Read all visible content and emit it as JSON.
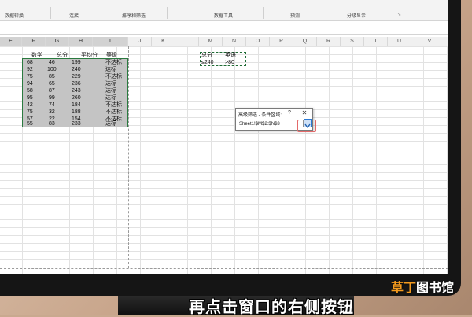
{
  "ribbon": {
    "groups": [
      "数据转换",
      "连接",
      "排序和筛选",
      "数据工具",
      "预测",
      "分级显示"
    ]
  },
  "columns": [
    "E",
    "F",
    "G",
    "H",
    "I",
    "J",
    "K",
    "L",
    "M",
    "N",
    "O",
    "P",
    "Q",
    "R",
    "S",
    "T",
    "U",
    "V"
  ],
  "table": {
    "headers": [
      "数学",
      "总分",
      "平均分",
      "等级"
    ],
    "rows": [
      [
        "68",
        "46",
        "199",
        "不达标"
      ],
      [
        "92",
        "100",
        "240",
        "达标"
      ],
      [
        "75",
        "85",
        "229",
        "不达标"
      ],
      [
        "94",
        "65",
        "236",
        "达标"
      ],
      [
        "58",
        "87",
        "243",
        "达标"
      ],
      [
        "95",
        "99",
        "260",
        "达标"
      ],
      [
        "42",
        "74",
        "184",
        "不达标"
      ],
      [
        "75",
        "32",
        "188",
        "不达标"
      ],
      [
        "57",
        "22",
        "154",
        "不达标"
      ],
      [
        "55",
        "83",
        "233",
        "达标"
      ]
    ]
  },
  "criteria": {
    "h1": "总分",
    "h2": "英语",
    "v1": "≤240",
    "v2": ">80"
  },
  "dialog": {
    "title": "高级筛选 - 条件区域:",
    "help": "?",
    "close": "✕",
    "value": "Sheet1!$M$2:$N$3"
  },
  "caption": "再点击窗口的右侧按钮",
  "watermark": {
    "part1": "草丁",
    "part2": "图书馆"
  }
}
